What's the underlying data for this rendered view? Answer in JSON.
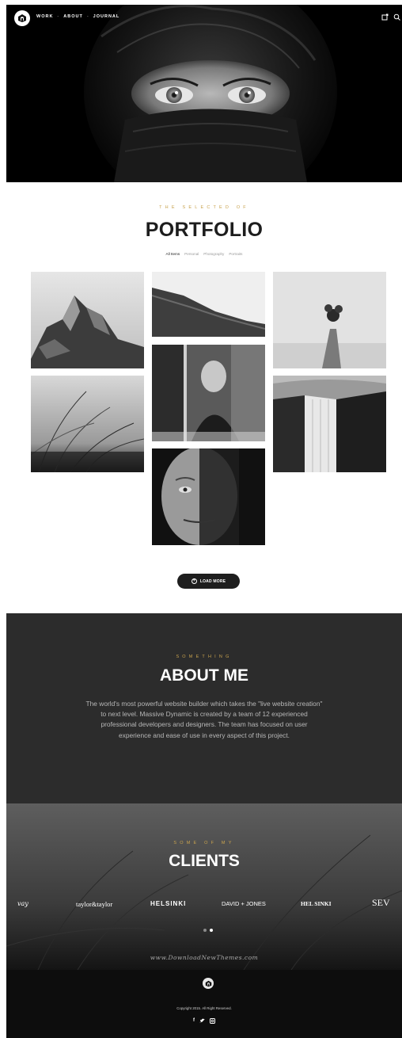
{
  "nav": {
    "links": [
      "WORK",
      "ABOUT",
      "JOURNAL"
    ],
    "separator": "-"
  },
  "portfolio": {
    "eyebrow": "THE SELECTED OF",
    "title": "PORTFOLIO",
    "filters": [
      "All Items",
      "Personal",
      "Photography",
      "Portraits"
    ],
    "active_filter": "All Items",
    "load_more_label": "LOAD MORE"
  },
  "about": {
    "eyebrow": "SOMETHING",
    "title": "ABOUT ME",
    "text": "The world's most powerful website builder which takes the \"live website creation\" to next level. Massive Dynamic is created by a team of 12 experienced professional developers and designers. The team has focused on user experience and ease of use in every aspect of this project."
  },
  "clients": {
    "eyebrow": "SOME OF MY",
    "title": "CLIENTS",
    "logos": [
      "vay",
      "taylor&taylor",
      "HELSINKI",
      "DAVID + JONES",
      "HEL SINKI",
      "SEV"
    ],
    "slider_pages": 2,
    "slider_active": 2,
    "watermark": "www.DownloadNewThemes.com"
  },
  "footer": {
    "copyright": "Copyright 2015. All Right Reserved.",
    "social": [
      "f",
      "twitter",
      "instagram"
    ]
  },
  "colors": {
    "accent_gold": "#c9a34e",
    "dark_section": "#2c2c2c",
    "footer_bg": "#0d0d0d"
  },
  "icons": {
    "nav": [
      "logo-icon",
      "cart-icon",
      "search-icon"
    ],
    "load_more": "plus-circle-icon",
    "social": [
      "facebook-icon",
      "twitter-icon",
      "instagram-icon"
    ]
  }
}
